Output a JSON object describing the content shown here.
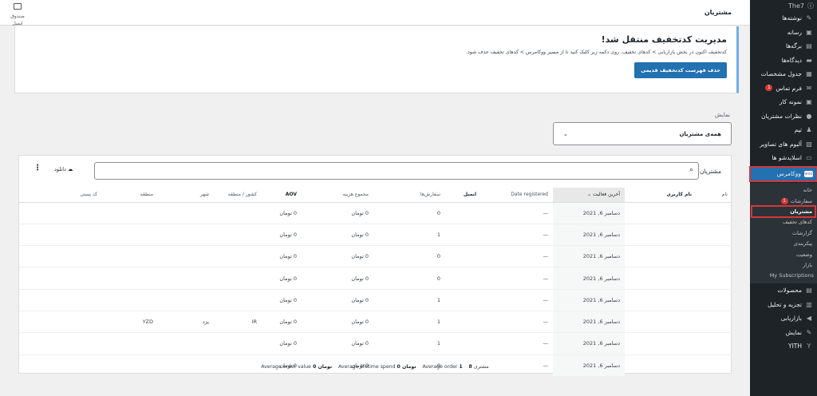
{
  "sidebar": {
    "top_label": "The7",
    "items": [
      {
        "label": "نوشته‌ها",
        "icon": "✎"
      },
      {
        "label": "رسانه",
        "icon": "▣"
      },
      {
        "label": "برگه‌ها",
        "icon": "▤"
      },
      {
        "label": "دیدگاه‌ها",
        "icon": "▬"
      },
      {
        "label": "جدول مشخصات",
        "icon": "▦"
      },
      {
        "label": "فرم تماس",
        "icon": "✉",
        "badge": "1"
      },
      {
        "label": "نمونه کار",
        "icon": "▣"
      },
      {
        "label": "نظرات مشتریان",
        "icon": "●"
      },
      {
        "label": "تیم",
        "icon": "♟"
      },
      {
        "label": "آلبوم های تصاویر",
        "icon": "▧"
      },
      {
        "label": "اسلایدشو ها",
        "icon": "▭"
      }
    ],
    "woo_label": "ووکامرس",
    "woo_icon": "woo",
    "woo_sub": [
      {
        "label": "خانه"
      },
      {
        "label": "سفارشات",
        "badge": "1"
      },
      {
        "label": "مشتریان",
        "current": true
      },
      {
        "label": "کدهای تخفیف"
      },
      {
        "label": "گزارشات"
      },
      {
        "label": "پیکربندی"
      },
      {
        "label": "وضعیت"
      },
      {
        "label": "بازار"
      },
      {
        "label": "My Subscriptions"
      }
    ],
    "bottom_items": [
      {
        "label": "محصولات",
        "icon": "▤"
      },
      {
        "label": "تجزیه و تحلیل",
        "icon": "▥"
      },
      {
        "label": "بازاریابی",
        "icon": "◀"
      },
      {
        "label": "نمایش",
        "icon": "✎"
      },
      {
        "label": "YITH",
        "icon": "Y"
      }
    ]
  },
  "topbar": {
    "page_title": "مشتریان",
    "inbox_label": "صندوق ایمیل"
  },
  "notice": {
    "title": "مدیریت کدتخفیف منتقل شد!",
    "text": "کدتخفیف اکنون در بخش بازاریابی > کدهای تخفیف. روی دکمه زیر کلیک کنید تا از مسیر ووکامرس > کدهای تخفیف حذف شود.",
    "button": "حذف فهرست کدتخفیف قدیمی"
  },
  "filter": {
    "label": "نمایش",
    "value": "همه‌ی مشتریان"
  },
  "table": {
    "search_label": "مشتریان",
    "download_label": "دانلود",
    "columns": [
      "نام",
      "نام کاربری",
      "آخرین فعالیت",
      "Date registered",
      "ایمیل",
      "سفارش‌ها",
      "مجموع هزینه",
      "AOV",
      "کشور / منطقه",
      "شهر",
      "منطقه",
      "کد پستی"
    ],
    "rows": [
      [
        "",
        "",
        "دسامبر 6, 2021",
        "—",
        "",
        "0",
        "0 تومان",
        "0 تومان",
        "",
        "",
        "",
        ""
      ],
      [
        "",
        "",
        "دسامبر 6, 2021",
        "—",
        "",
        "1",
        "0 تومان",
        "0 تومان",
        "",
        "",
        "",
        ""
      ],
      [
        "",
        "",
        "دسامبر 6, 2021",
        "—",
        "",
        "0",
        "0 تومان",
        "0 تومان",
        "",
        "",
        "",
        ""
      ],
      [
        "",
        "",
        "دسامبر 6, 2021",
        "—",
        "",
        "0",
        "0 تومان",
        "0 تومان",
        "",
        "",
        "",
        ""
      ],
      [
        "",
        "",
        "دسامبر 6, 2021",
        "—",
        "",
        "1",
        "0 تومان",
        "0 تومان",
        "",
        "",
        "",
        ""
      ],
      [
        "",
        "",
        "دسامبر 6, 2021",
        "—",
        "",
        "1",
        "0 تومان",
        "0 تومان",
        "IR",
        "یزد",
        "YZD",
        ""
      ],
      [
        "",
        "",
        "دسامبر 6, 2021",
        "—",
        "",
        "1",
        "0 تومان",
        "0 تومان",
        "",
        "",
        "",
        ""
      ],
      [
        "",
        "",
        "دسامبر 6, 2021",
        "—",
        "",
        "0",
        "0 تومان",
        "0 تومان",
        "",
        "",
        "",
        ""
      ]
    ],
    "summary": {
      "customers_count": "8",
      "customers_label": "مشتری",
      "avg_order_label": "Average order",
      "avg_order_value": "1",
      "lifetime_value": "0 تومان",
      "lifetime_label": "Average lifetime spend",
      "aov_value": "0 تومان",
      "aov_label": "Average order value"
    }
  },
  "colors": {
    "accent": "#2271b1",
    "sidebar_bg": "#1d2327",
    "highlight": "#d63638"
  }
}
